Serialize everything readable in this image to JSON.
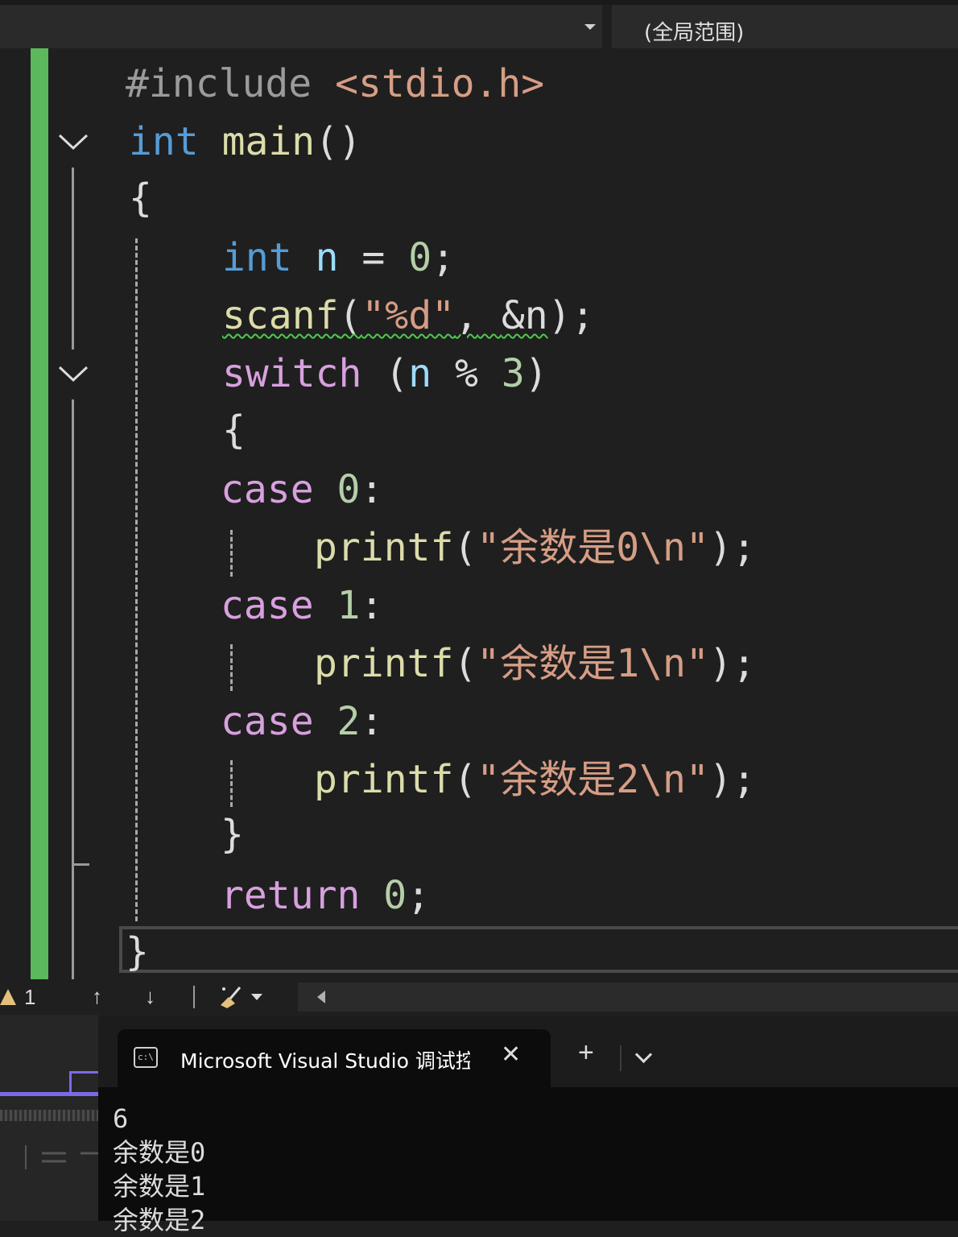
{
  "toolbar": {
    "scope_label": "(全局范围)"
  },
  "editor": {
    "lines": [
      "#include <stdio.h>",
      "int main()",
      "{",
      "int n = 0;",
      "scanf(\"%d\", &n);",
      "switch (n % 3)",
      "{",
      "case 0:",
      "printf(\"余数是0\\n\");",
      "case 1:",
      "printf(\"余数是1\\n\");",
      "case 2:",
      "printf(\"余数是2\\n\");",
      "}",
      "return 0;",
      "}"
    ],
    "tokens": {
      "include": "#include",
      "header": "<stdio.h>",
      "int": "int",
      "main": "main",
      "parens": "()",
      "n": "n",
      "eq": "=",
      "zero": "0",
      "semi": ";",
      "scanf": "scanf",
      "scanf_args_open": "(",
      "fmt": "\"%d\"",
      "comma": ",",
      "addr_n": "&n",
      "close_semi": ");",
      "switch": "switch",
      "switch_expr_open": "(",
      "mod": "%",
      "three": "3",
      "paren_close": ")",
      "lbrace": "{",
      "rbrace": "}",
      "case": "case",
      "colon": ":",
      "one": "1",
      "two": "2",
      "printf": "printf",
      "open": "(",
      "str0": "\"余数是0\\n\"",
      "str1": "\"余数是1\\n\"",
      "str2": "\"余数是2\\n\"",
      "return": "return"
    }
  },
  "statusbar": {
    "warning_count": "1",
    "up_arrow": "↑",
    "down_arrow": "↓"
  },
  "terminal": {
    "tab_title": "Microsoft Visual Studio 调试控",
    "close": "✕",
    "new_tab": "+",
    "output": [
      "6",
      "余数是0",
      "余数是1",
      "余数是2"
    ]
  },
  "icons": [
    "chevron-down-icon",
    "warning-icon",
    "cleanup-brush-icon",
    "console-icon",
    "close-icon",
    "plus-icon"
  ]
}
